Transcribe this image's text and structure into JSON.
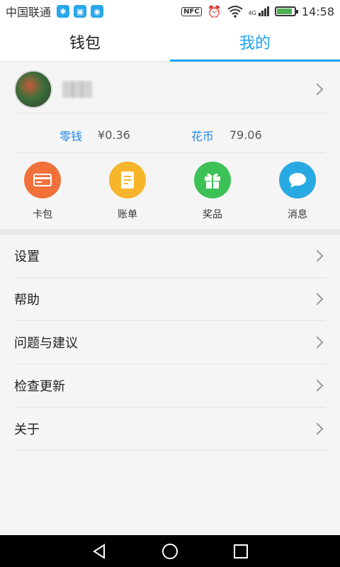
{
  "status_bar": {
    "carrier": "中国联通",
    "icons": [
      "bluetooth-icon",
      "image-icon",
      "wifi-hotspot-icon"
    ],
    "nfc": "NFC",
    "network": "4G",
    "battery_level": 0.8,
    "time": "14:58"
  },
  "tabs": [
    {
      "label": "钱包",
      "active": false
    },
    {
      "label": "我的",
      "active": true
    }
  ],
  "profile": {
    "username": "▒▒▒"
  },
  "balances": [
    {
      "label": "零钱",
      "value": "¥0.36"
    },
    {
      "label": "花币",
      "value": "79.06"
    }
  ],
  "quick_actions": [
    {
      "label": "卡包",
      "icon": "card-icon",
      "color": "#f2703a"
    },
    {
      "label": "账单",
      "icon": "bill-icon",
      "color": "#f7b52c"
    },
    {
      "label": "奖品",
      "icon": "gift-icon",
      "color": "#3cc157"
    },
    {
      "label": "消息",
      "icon": "message-icon",
      "color": "#29a9e1"
    }
  ],
  "menu": [
    {
      "label": "设置"
    },
    {
      "label": "帮助"
    },
    {
      "label": "问题与建议"
    },
    {
      "label": "检查更新"
    },
    {
      "label": "关于"
    }
  ],
  "nav": [
    "back-icon",
    "home-icon",
    "recents-icon"
  ]
}
